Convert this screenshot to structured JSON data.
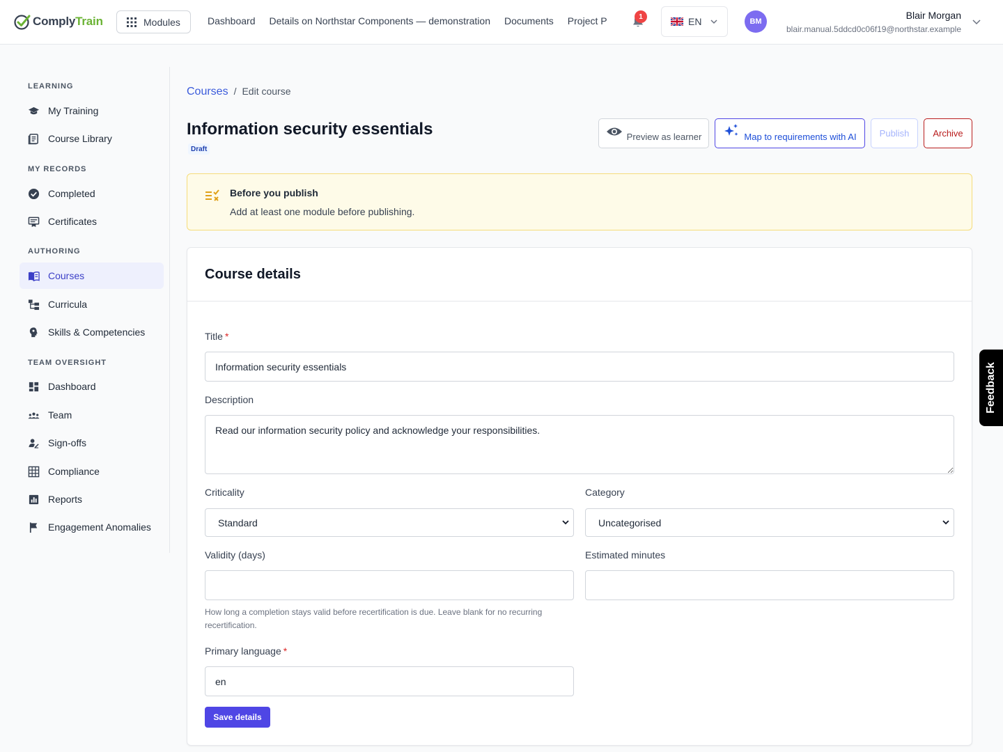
{
  "brand": {
    "name_part1": "Comply",
    "name_part2": "Train",
    "accent": "#6bb335"
  },
  "header": {
    "modules_label": "Modules",
    "nav": [
      "Dashboard",
      "Details on Northstar Components — demonstration",
      "Documents",
      "Project Plan"
    ],
    "notification_count": "1",
    "language": "EN",
    "user": {
      "initials": "BM",
      "name": "Blair Morgan",
      "email": "blair.manual.5ddcd0c06f19@northstar.example"
    }
  },
  "sidebar": {
    "sections": [
      "LEARNING",
      "MY RECORDS",
      "AUTHORING",
      "TEAM OVERSIGHT"
    ],
    "items": [
      {
        "label": "My Training",
        "icon": "graduation-cap-icon"
      },
      {
        "label": "Course Library",
        "icon": "book-icon"
      },
      {
        "label": "Completed",
        "icon": "check-circle-icon"
      },
      {
        "label": "Certificates",
        "icon": "certificate-icon"
      },
      {
        "label": "Courses",
        "icon": "open-book-icon",
        "active": true
      },
      {
        "label": "Curricula",
        "icon": "hierarchy-icon"
      },
      {
        "label": "Skills & Competencies",
        "icon": "brain-icon"
      },
      {
        "label": "Dashboard",
        "icon": "dashboard-icon"
      },
      {
        "label": "Team",
        "icon": "team-icon"
      },
      {
        "label": "Sign-offs",
        "icon": "user-sign-icon"
      },
      {
        "label": "Compliance",
        "icon": "grid-icon"
      },
      {
        "label": "Reports",
        "icon": "bar-chart-icon"
      },
      {
        "label": "Engagement Anomalies",
        "icon": "flag-icon"
      }
    ]
  },
  "breadcrumb": {
    "root": "Courses",
    "separator": "/",
    "current": "Edit course"
  },
  "page": {
    "title": "Information security essentials",
    "status": "Draft"
  },
  "actions": {
    "preview": "Preview as learner",
    "map_ai": "Map to requirements with AI",
    "publish": "Publish",
    "archive": "Archive"
  },
  "notice": {
    "title": "Before you publish",
    "text": "Add at least one module before publishing."
  },
  "form": {
    "heading": "Course details",
    "title_label": "Title",
    "title_value": "Information security essentials",
    "description_label": "Description",
    "description_value": "Read our information security policy and acknowledge your responsibilities.",
    "criticality_label": "Criticality",
    "criticality_value": "Standard",
    "category_label": "Category",
    "category_value": "Uncategorised",
    "validity_label": "Validity (days)",
    "validity_value": "",
    "validity_help": "How long a completion stays valid before recertification is due. Leave blank for no recurring recertification.",
    "minutes_label": "Estimated minutes",
    "minutes_value": "",
    "language_label": "Primary language",
    "language_value": "en",
    "required_marker": "*",
    "save_label": "Save details"
  },
  "feedback_label": "Feedback"
}
